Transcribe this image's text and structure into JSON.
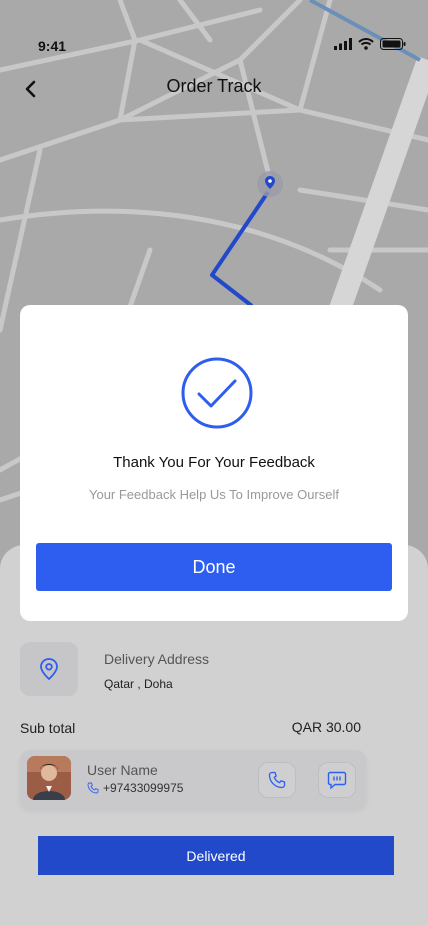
{
  "status": {
    "time": "9:41"
  },
  "header": {
    "title": "Order Track"
  },
  "modal": {
    "title": "Thank You For Your Feedback",
    "subtitle": "Your Feedback Help Us To Improve Ourself",
    "done_label": "Done"
  },
  "delivery": {
    "label": "Delivery Address",
    "address": "Qatar , Doha"
  },
  "subtotal": {
    "label": "Sub total",
    "value": "QAR 30.00"
  },
  "driver": {
    "name": "User Name",
    "phone": "+97433099975"
  },
  "actions": {
    "delivered_label": "Delivered"
  },
  "colors": {
    "accent": "#2d5ef0",
    "route": "#2149c9",
    "overlay_bg": "#d1d1d1"
  },
  "icons": [
    "back-arrow-icon",
    "signal-icon",
    "wifi-icon",
    "battery-icon",
    "map-pin-icon",
    "check-icon",
    "location-pin-icon",
    "phone-icon",
    "chat-icon"
  ]
}
